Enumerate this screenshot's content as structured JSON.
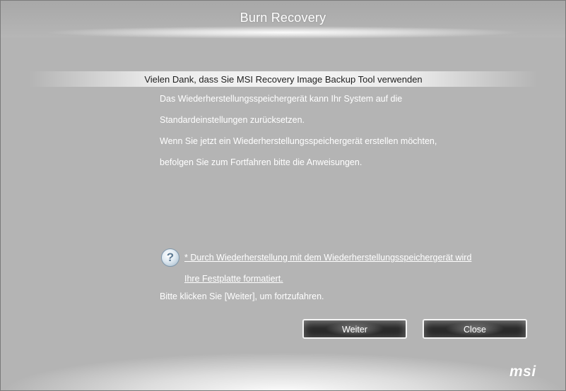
{
  "window": {
    "title": "Burn Recovery"
  },
  "banner": {
    "text": "Vielen Dank, dass Sie MSI Recovery Image Backup Tool verwenden"
  },
  "body": {
    "lines": [
      "Das Wiederherstellungsspeichergerät kann Ihr System auf die",
      "Standardeinstellungen zurücksetzen.",
      "Wenn Sie jetzt ein Wiederherstellungsspeichergerät erstellen möchten,",
      "befolgen Sie zum Fortfahren bitte die Anweisungen."
    ]
  },
  "warning": {
    "icon": "question-icon",
    "icon_glyph": "?",
    "line1": "* Durch Wiederherstellung mit dem Wiederherstellungsspeichergerät wird",
    "line2": "Ihre Festplatte formatiert."
  },
  "instruction": {
    "text": "Bitte klicken Sie [Weiter], um fortzufahren."
  },
  "buttons": {
    "next_label": "Weiter",
    "close_label": "Close"
  },
  "brand": {
    "logo_text": "msi"
  },
  "colors": {
    "background": "#b4b4b4",
    "text": "#ffffff",
    "button": "#2b2b2b"
  }
}
